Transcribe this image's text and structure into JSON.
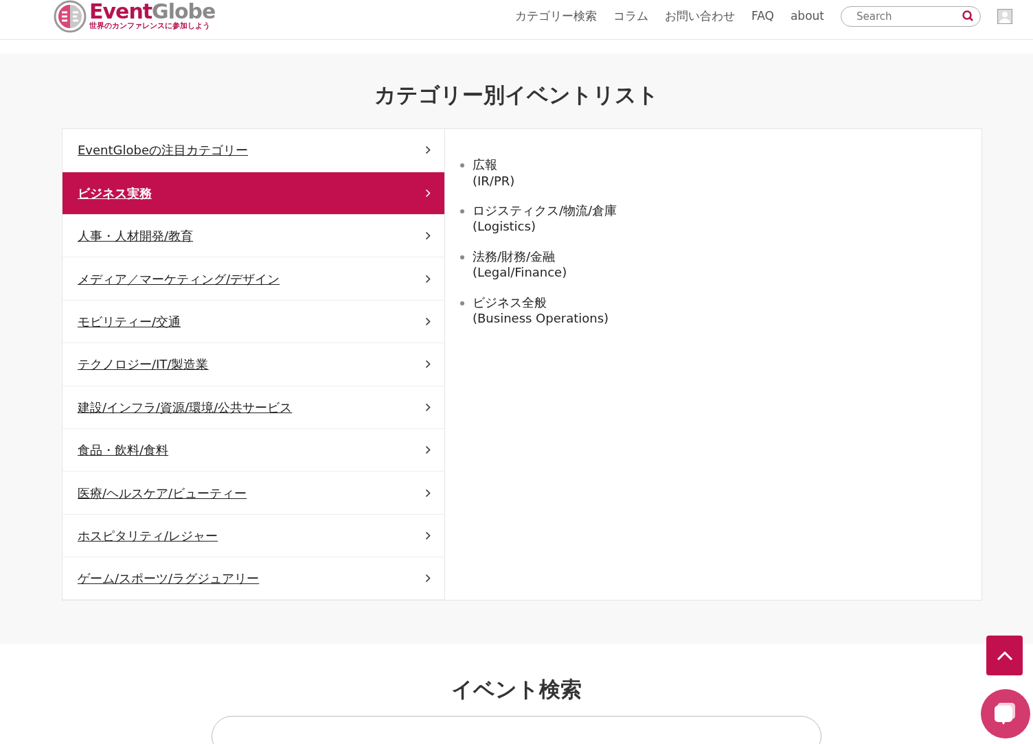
{
  "header": {
    "logo_word_1": "Event",
    "logo_word_2": "Globe",
    "tagline": "世界のカンファレンスに参加しよう",
    "nav": [
      "カテゴリー検索",
      "コラム",
      "お問い合わせ",
      "FAQ",
      "about"
    ],
    "search": {
      "placeholder": "Search"
    }
  },
  "category_section": {
    "title": "カテゴリー別イベントリスト",
    "categories": [
      {
        "label": "EventGlobeの注目カテゴリー",
        "selected": false
      },
      {
        "label": "ビジネス実務",
        "selected": true
      },
      {
        "label": "人事・人材開発/教育",
        "selected": false
      },
      {
        "label": "メディア／マーケティング/デザイン",
        "selected": false
      },
      {
        "label": "モビリティー/交通",
        "selected": false
      },
      {
        "label": "テクノロジー/IT/製造業",
        "selected": false
      },
      {
        "label": "建設/インフラ/資源/環境/公共サービス",
        "selected": false
      },
      {
        "label": "食品・飲料/食料",
        "selected": false
      },
      {
        "label": "医療/ヘルスケア/ビューティー",
        "selected": false
      },
      {
        "label": "ホスピタリティ/レジャー",
        "selected": false
      },
      {
        "label": "ゲーム/スポーツ/ラグジュアリー",
        "selected": false
      }
    ],
    "subcategories": [
      {
        "name": "広報",
        "english": "(IR/PR)"
      },
      {
        "name": "ロジスティクス/物流/倉庫",
        "english": "(Logistics)"
      },
      {
        "name": "法務/財務/金融",
        "english": "(Legal/Finance)"
      },
      {
        "name": "ビジネス全般",
        "english": "(Business Operations)"
      }
    ]
  },
  "search_section": {
    "title": "イベント検索"
  }
}
